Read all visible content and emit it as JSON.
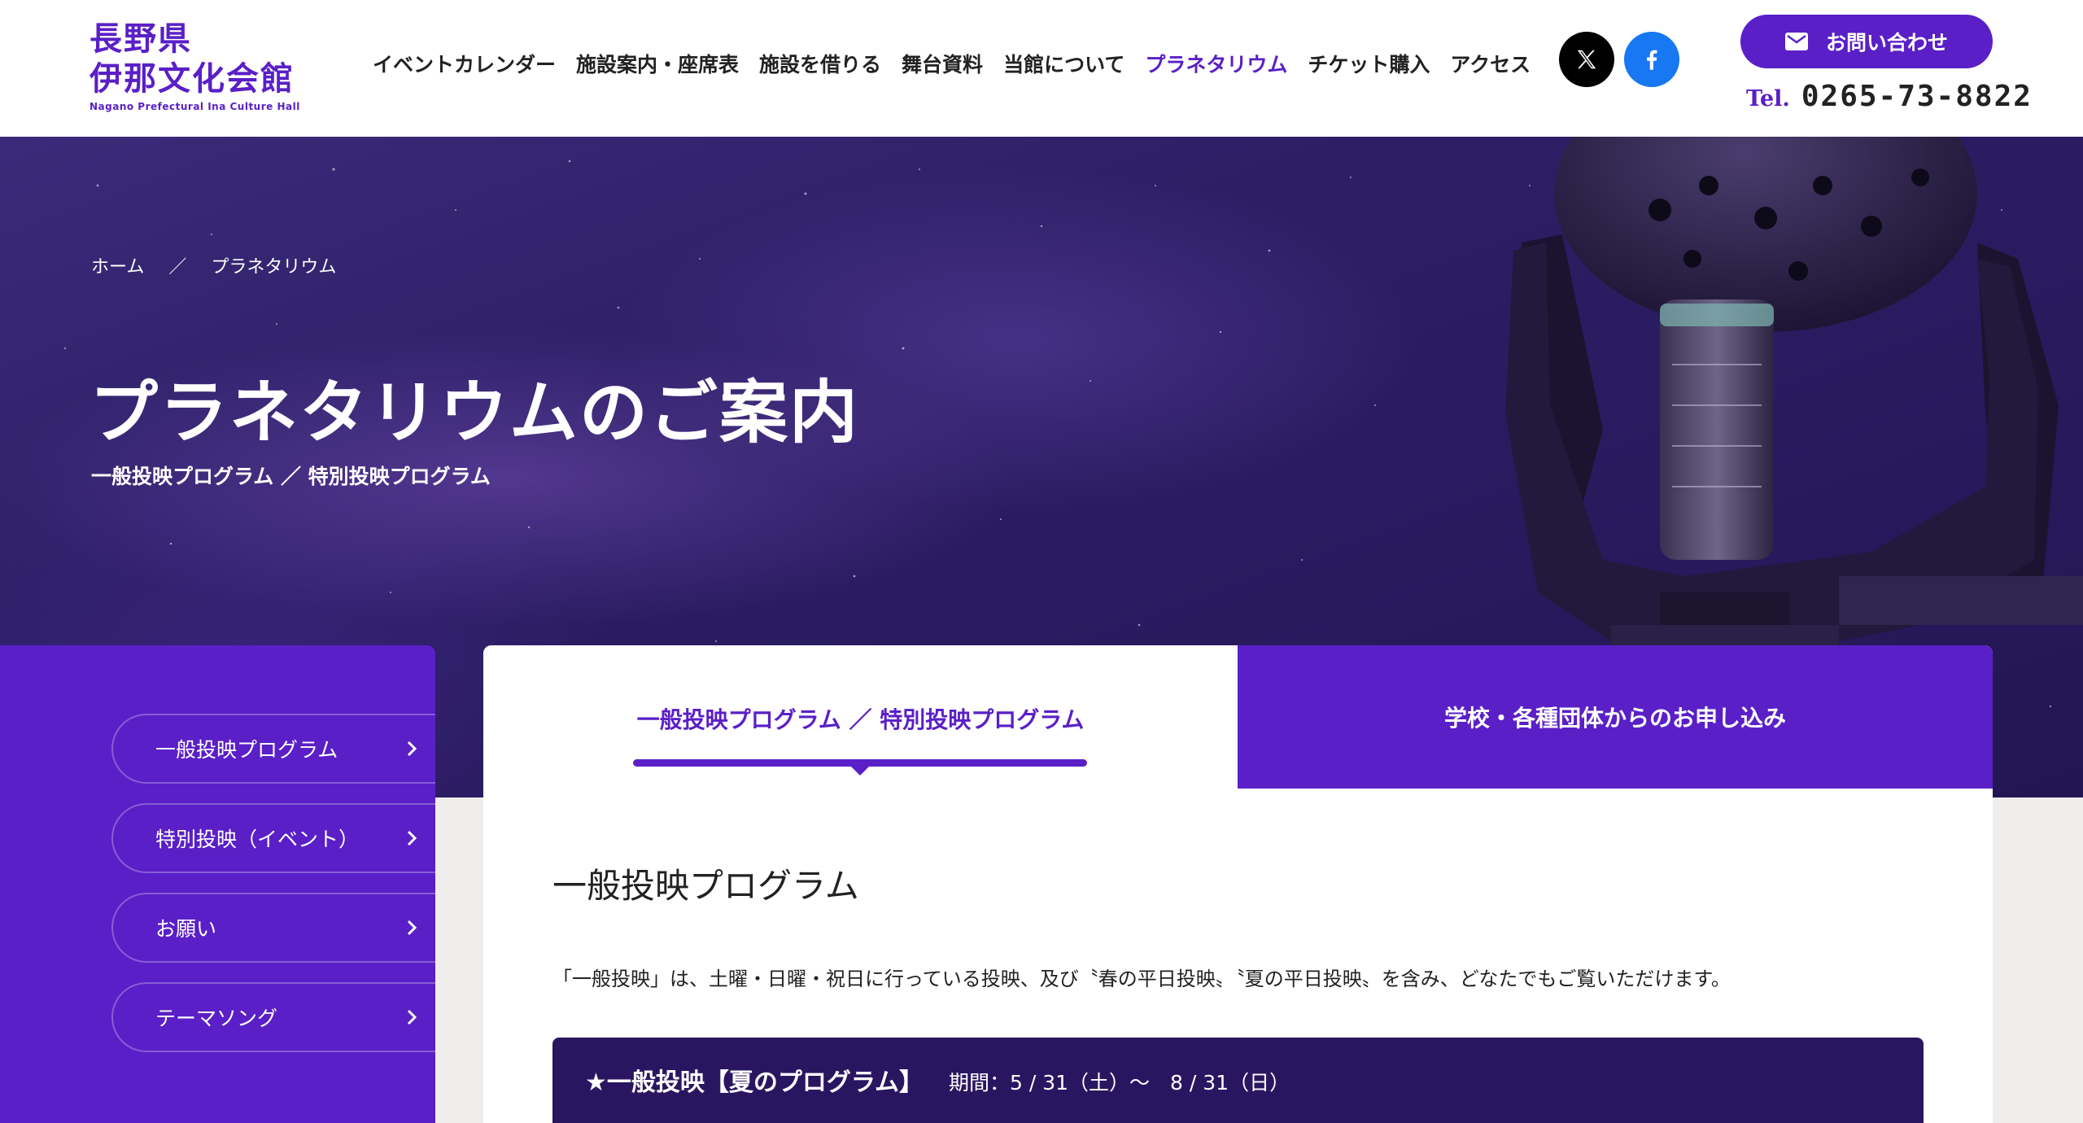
{
  "header": {
    "logo": {
      "line1": "長野県",
      "line2": "伊那文化会館",
      "line3": "Nagano Prefectural Ina Culture Hall"
    },
    "nav": [
      {
        "label": "イベントカレンダー",
        "active": false
      },
      {
        "label": "施設案内・座席表",
        "active": false
      },
      {
        "label": "施設を借りる",
        "active": false
      },
      {
        "label": "舞台資料",
        "active": false
      },
      {
        "label": "当館について",
        "active": false
      },
      {
        "label": "プラネタリウム",
        "active": true
      },
      {
        "label": "チケット購入",
        "active": false
      },
      {
        "label": "アクセス",
        "active": false
      }
    ],
    "sns": {
      "x_icon": "x-logo-icon",
      "facebook_icon": "facebook-icon"
    },
    "contact_label": "お問い合わせ",
    "tel_label": "Tel.",
    "tel_number": "0265-73-8822"
  },
  "hero": {
    "breadcrumb": {
      "home": "ホーム",
      "separator": "／",
      "current": "プラネタリウム"
    },
    "title": "プラネタリウムのご案内",
    "subtitle": "一般投映プログラム ／ 特別投映プログラム"
  },
  "sidebar": {
    "items": [
      {
        "label": "一般投映プログラム"
      },
      {
        "label": "特別投映（イベント）"
      },
      {
        "label": "お願い"
      },
      {
        "label": "テーマソング"
      }
    ]
  },
  "main": {
    "tabs": [
      {
        "label": "一般投映プログラム ／ 特別投映プログラム",
        "active": true
      },
      {
        "label": "学校・各種団体からのお申し込み",
        "active": false
      }
    ],
    "section_title": "一般投映プログラム",
    "intro": "「一般投映」は、土曜・日曜・祝日に行っている投映、及び〝春の平日投映〟〝夏の平日投映〟を含み、どなたでもご覧いただけます。",
    "program": {
      "title": "★一般投映【夏のプログラム】",
      "period": "期間：5 / 31（土）〜　8 / 31（日）"
    }
  },
  "colors": {
    "accent": "#5a1fc7",
    "hero_dark": "#2a1b60",
    "banner": "#2a1660",
    "page_bg": "#efecec"
  }
}
